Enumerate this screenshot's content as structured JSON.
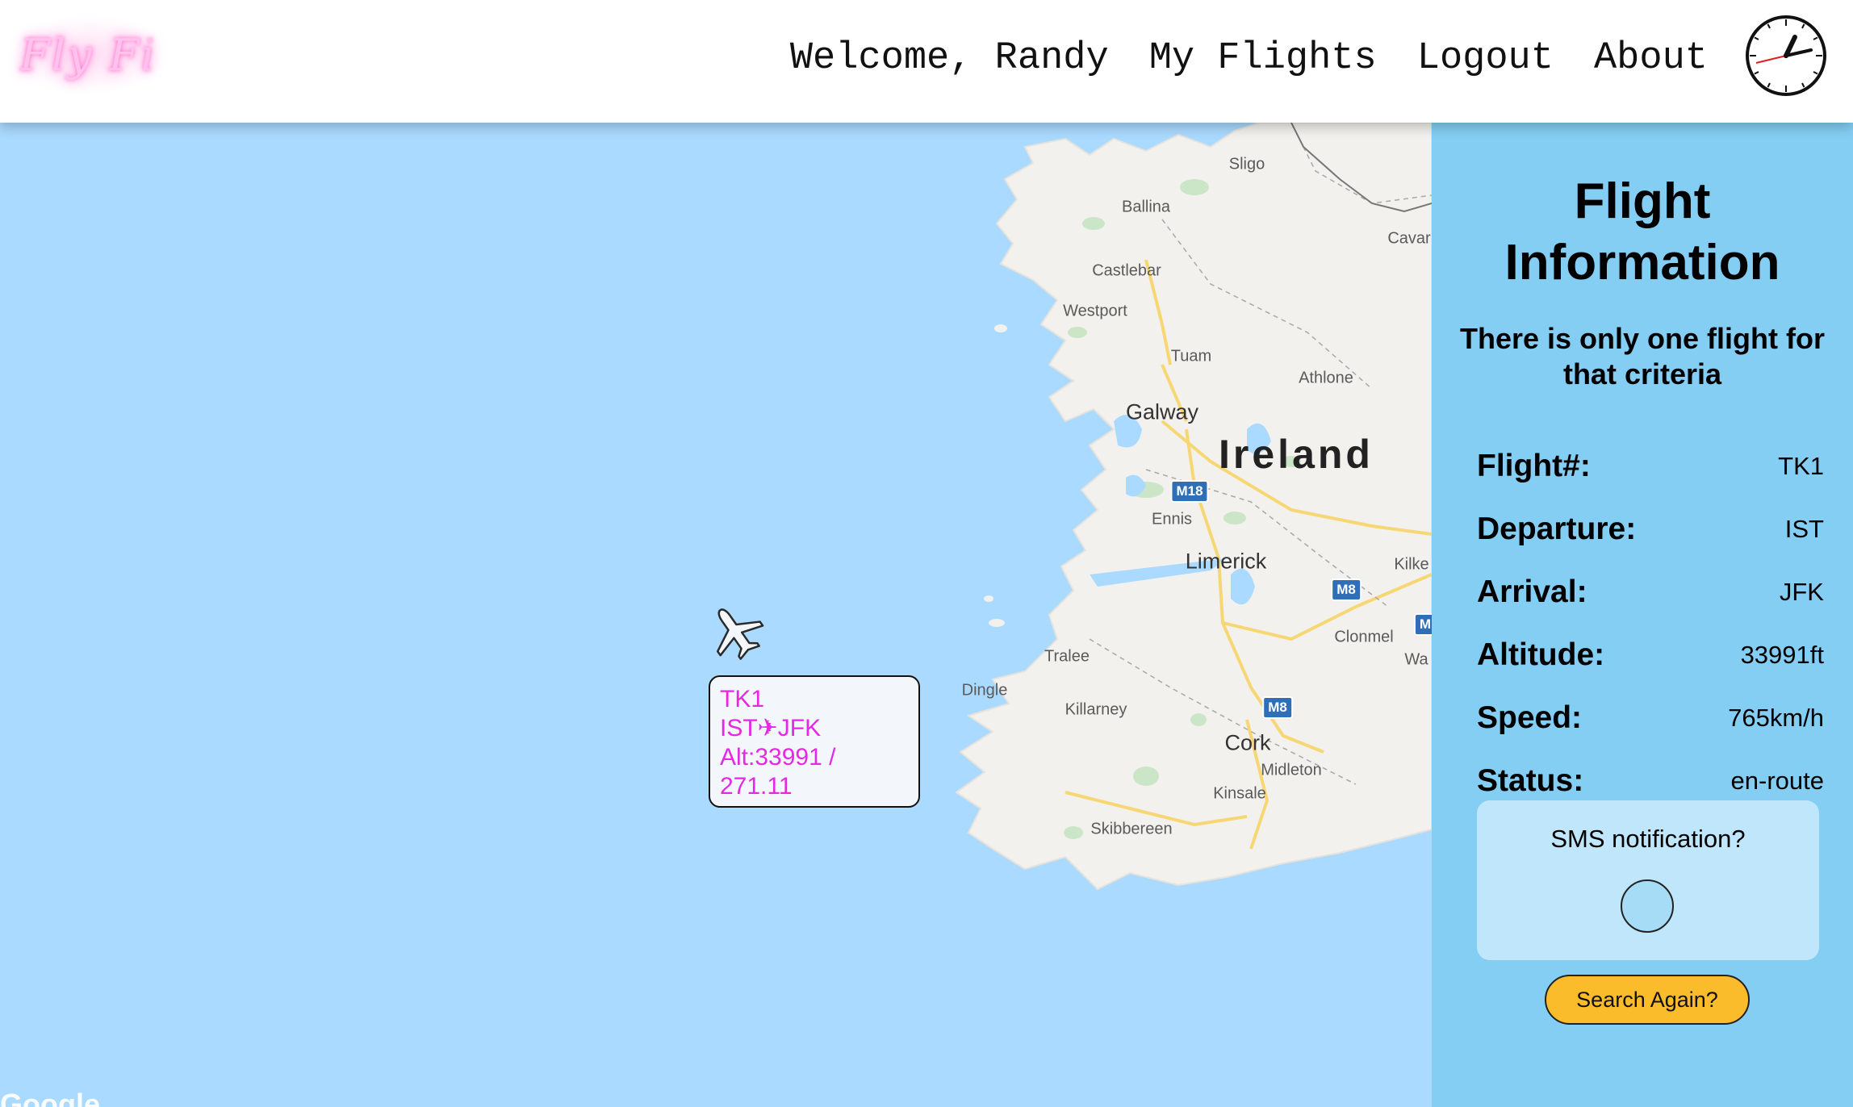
{
  "header": {
    "logo_text": "Fly Fi",
    "nav": {
      "welcome": "Welcome, Randy",
      "my_flights": "My Flights",
      "logout": "Logout",
      "about": "About"
    },
    "clock_icon": "analog-clock-icon"
  },
  "map": {
    "country_label": "Ireland",
    "city_labels": [
      "Galway",
      "Limerick",
      "Cork"
    ],
    "town_labels": [
      "Sligo",
      "Ballina",
      "Castlebar",
      "Westport",
      "Tuam",
      "Athlone",
      "Ennis",
      "Tralee",
      "Dingle",
      "Killarney",
      "Clonmel",
      "Midleton",
      "Kinsale",
      "Skibbereen",
      "Cavar",
      "Kilke",
      "Wa"
    ],
    "road_shields": [
      "M18",
      "M8",
      "M8",
      "M"
    ],
    "attribution": "Google",
    "plane_icon": "airplane-icon",
    "tooltip": {
      "line1": "TK1",
      "line2": "IST✈JFK",
      "line3": "Alt:33991 /",
      "line4": "271.11"
    },
    "colors": {
      "water": "#aadaff",
      "land": "#f2f1ee",
      "tooltip_text": "#e428e4"
    }
  },
  "panel": {
    "title": "Flight Information",
    "subtitle": "There is only one flight for that criteria",
    "rows": [
      {
        "label": "Flight#:",
        "value": "TK1"
      },
      {
        "label": "Departure:",
        "value": "IST"
      },
      {
        "label": "Arrival:",
        "value": "JFK"
      },
      {
        "label": "Altitude:",
        "value": "33991ft"
      },
      {
        "label": "Speed:",
        "value": "765km/h"
      },
      {
        "label": "Status:",
        "value": "en-route"
      }
    ],
    "sms_label": "SMS notification?",
    "search_button": "Search Again?",
    "colors": {
      "background": "#84cef4",
      "sms_box": "#bfe6fa",
      "button": "#fbbc2c"
    }
  }
}
